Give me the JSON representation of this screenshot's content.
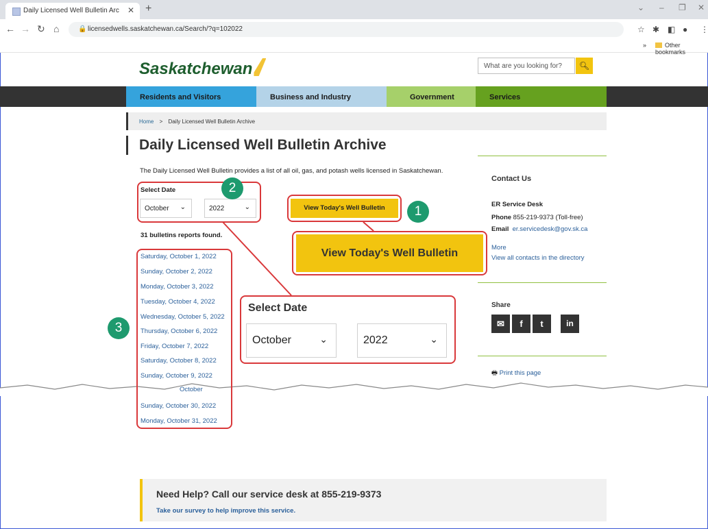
{
  "browser": {
    "tab_title": "Daily Licensed Well Bulletin Archi",
    "url": "licensedwells.saskatchewan.ca/Search/?q=102022",
    "bookmark_chevron": "»",
    "bookmark_folder": "Other bookmarks"
  },
  "site": {
    "logo": "Saskatchewan",
    "search_placeholder": "What are you looking for?",
    "nav": [
      {
        "label": "Residents and Visitors",
        "color": "#35a3dc"
      },
      {
        "label": "Business and Industry",
        "color": "#b4d3e8"
      },
      {
        "label": "Government",
        "color": "#a6d06a"
      },
      {
        "label": "Services",
        "color": "#66a11f"
      }
    ],
    "breadcrumb": {
      "home": "Home",
      "sep": ">",
      "current": "Daily Licensed Well Bulletin Archive"
    },
    "title": "Daily Licensed Well Bulletin Archive",
    "intro": "The Daily Licensed Well Bulletin provides a list of all oil, gas, and potash wells licensed in Saskatchewan.",
    "select_date_label": "Select Date",
    "month": "October",
    "year": "2022",
    "view_button": "View Today's Well Bulletin",
    "count_text": "31 bulletins reports found.",
    "bulletins": [
      "Saturday, October 1, 2022",
      "Sunday, October 2, 2022",
      "Monday, October 3, 2022",
      "Tuesday, October 4, 2022",
      "Wednesday, October 5, 2022",
      "Thursday, October 6, 2022",
      "Friday, October 7, 2022",
      "Saturday, October 8, 2022",
      "Sunday, October 9, 2022",
      "Sunday, October 30, 2022",
      "Monday, October 31, 2022"
    ],
    "partial_item": "October",
    "sidebar": {
      "contact_heading": "Contact Us",
      "desk": "ER Service Desk",
      "phone_label": "Phone",
      "phone": "855-219-9373 (Toll-free)",
      "email_label": "Email",
      "email": "er.servicedesk@gov.sk.ca",
      "more": "More",
      "all_contacts": "View all contacts in the directory",
      "share_heading": "Share",
      "print": "Print this page"
    },
    "help_heading": "Need Help? Call our service desk at 855-219-9373",
    "help_link": "Take our survey to help improve this service."
  },
  "annotations": {
    "badge1": "1",
    "badge2": "2",
    "badge3": "3",
    "zoom_select_label": "Select Date",
    "zoom_month": "October",
    "zoom_year": "2022",
    "zoom_button": "View Today's Well Bulletin"
  }
}
